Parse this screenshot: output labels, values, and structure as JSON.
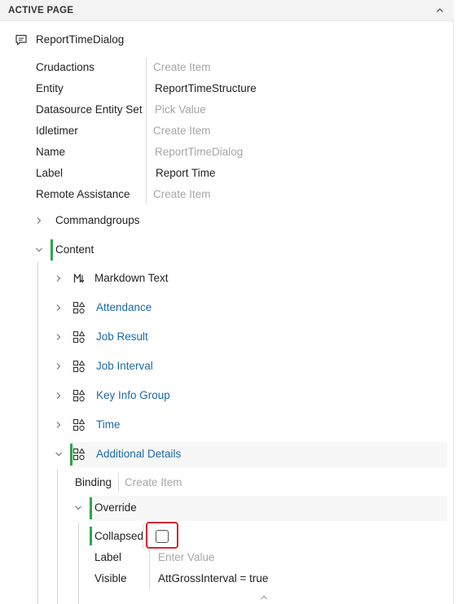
{
  "panel": {
    "header_title": "ACTIVE PAGE",
    "icons": {
      "collapse": "chevron-up-icon",
      "root": "comment-icon",
      "markdown": "markdown-icon",
      "group": "group-shapes-icon"
    }
  },
  "root": {
    "label": "ReportTimeDialog",
    "properties": [
      {
        "label": "Crudactions",
        "value": "Create Item",
        "placeholder": true
      },
      {
        "label": "Entity",
        "value": "ReportTimeStructure",
        "placeholder": false
      },
      {
        "label": "Datasource Entity Set",
        "value": "Pick Value",
        "placeholder": true
      },
      {
        "label": "Idletimer",
        "value": "Create Item",
        "placeholder": true
      },
      {
        "label": "Name",
        "value": "ReportTimeDialog",
        "placeholder": true
      },
      {
        "label": "Label",
        "value": "Report Time",
        "placeholder": false
      },
      {
        "label": "Remote Assistance",
        "value": "Create Item",
        "placeholder": true
      }
    ]
  },
  "tree": {
    "commandgroups": "Commandgroups",
    "content": "Content",
    "children": [
      {
        "label": "Markdown Text",
        "link": false,
        "icon": "markdown-icon"
      },
      {
        "label": "Attendance",
        "link": true,
        "icon": "group-shapes-icon"
      },
      {
        "label": "Job Result",
        "link": true,
        "icon": "group-shapes-icon"
      },
      {
        "label": "Job Interval",
        "link": true,
        "icon": "group-shapes-icon"
      },
      {
        "label": "Key Info Group",
        "link": true,
        "icon": "group-shapes-icon"
      },
      {
        "label": "Time",
        "link": true,
        "icon": "group-shapes-icon"
      },
      {
        "label": "Additional Details",
        "link": true,
        "icon": "group-shapes-icon"
      }
    ],
    "additional_details": {
      "binding_label": "Binding",
      "binding_value": "Create Item",
      "override_label": "Override",
      "override": {
        "collapsed_label": "Collapsed",
        "collapsed_checked": false,
        "label_label": "Label",
        "label_value": "Enter Value",
        "visible_label": "Visible",
        "visible_value": "AttGrossInterval = true"
      }
    }
  },
  "colors": {
    "accent_green": "#2ea44f",
    "link_blue": "#1a6aa8",
    "placeholder_gray": "#a6a6a6",
    "highlight_red": "#d9232d"
  }
}
